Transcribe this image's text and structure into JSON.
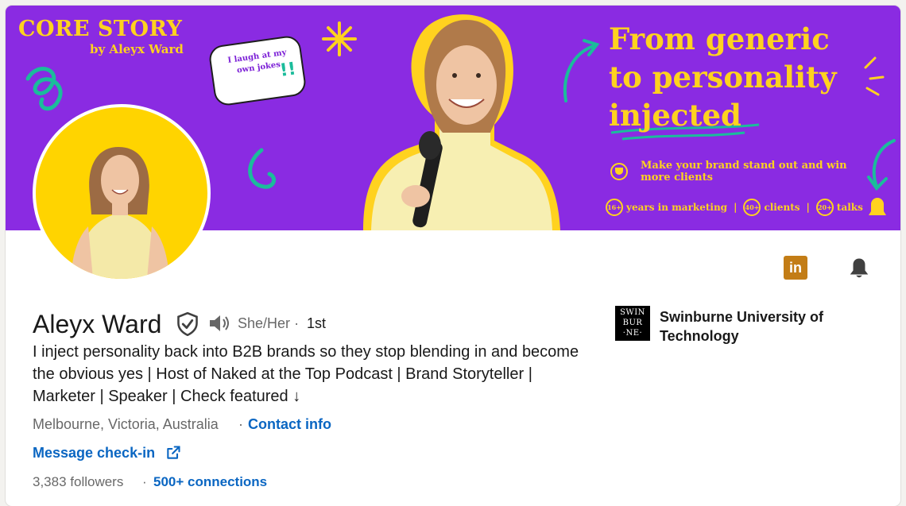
{
  "banner": {
    "brand_title": "CORE STORY",
    "brand_sub": "by Aleyx Ward",
    "bubble_text": "I laugh at my own jokes",
    "bubble_bang": "!!",
    "headline": [
      "From generic",
      "to personality",
      "injected"
    ],
    "tagline": "Make your brand stand out and win more clients",
    "stats": [
      {
        "badge": "16+",
        "label": "years in marketing"
      },
      {
        "badge": "40+",
        "label": "clients"
      },
      {
        "badge": "20+",
        "label": "talks"
      }
    ],
    "stat_separator": "|",
    "colors": {
      "background": "#8a2be2",
      "accent": "#ffd21f",
      "teal": "#1bbc9b"
    }
  },
  "actions": {
    "linkedin_icon": "in"
  },
  "profile": {
    "name": "Aleyx Ward",
    "pronouns": "She/Her",
    "degree_separator": "·",
    "degree": "1st",
    "headline": "I inject personality back into B2B brands so they stop blending in and become the obvious yes | Host of Naked at the Top Podcast | Brand Storyteller | Marketer | Speaker | Check featured ↓",
    "location": "Melbourne, Victoria, Australia",
    "location_separator": "·",
    "contact_info": "Contact info",
    "message_link": "Message check-in",
    "followers": "3,383 followers",
    "followers_separator": "·",
    "connections": "500+ connections"
  },
  "education": {
    "logo_lines": [
      "SWIN",
      "BUR",
      "·NE·"
    ],
    "school": "Swinburne University of Technology"
  },
  "colors": {
    "link": "#0a66c2",
    "avatar_bg": "#ffd400",
    "linkedin_badge": "#c37d16"
  }
}
